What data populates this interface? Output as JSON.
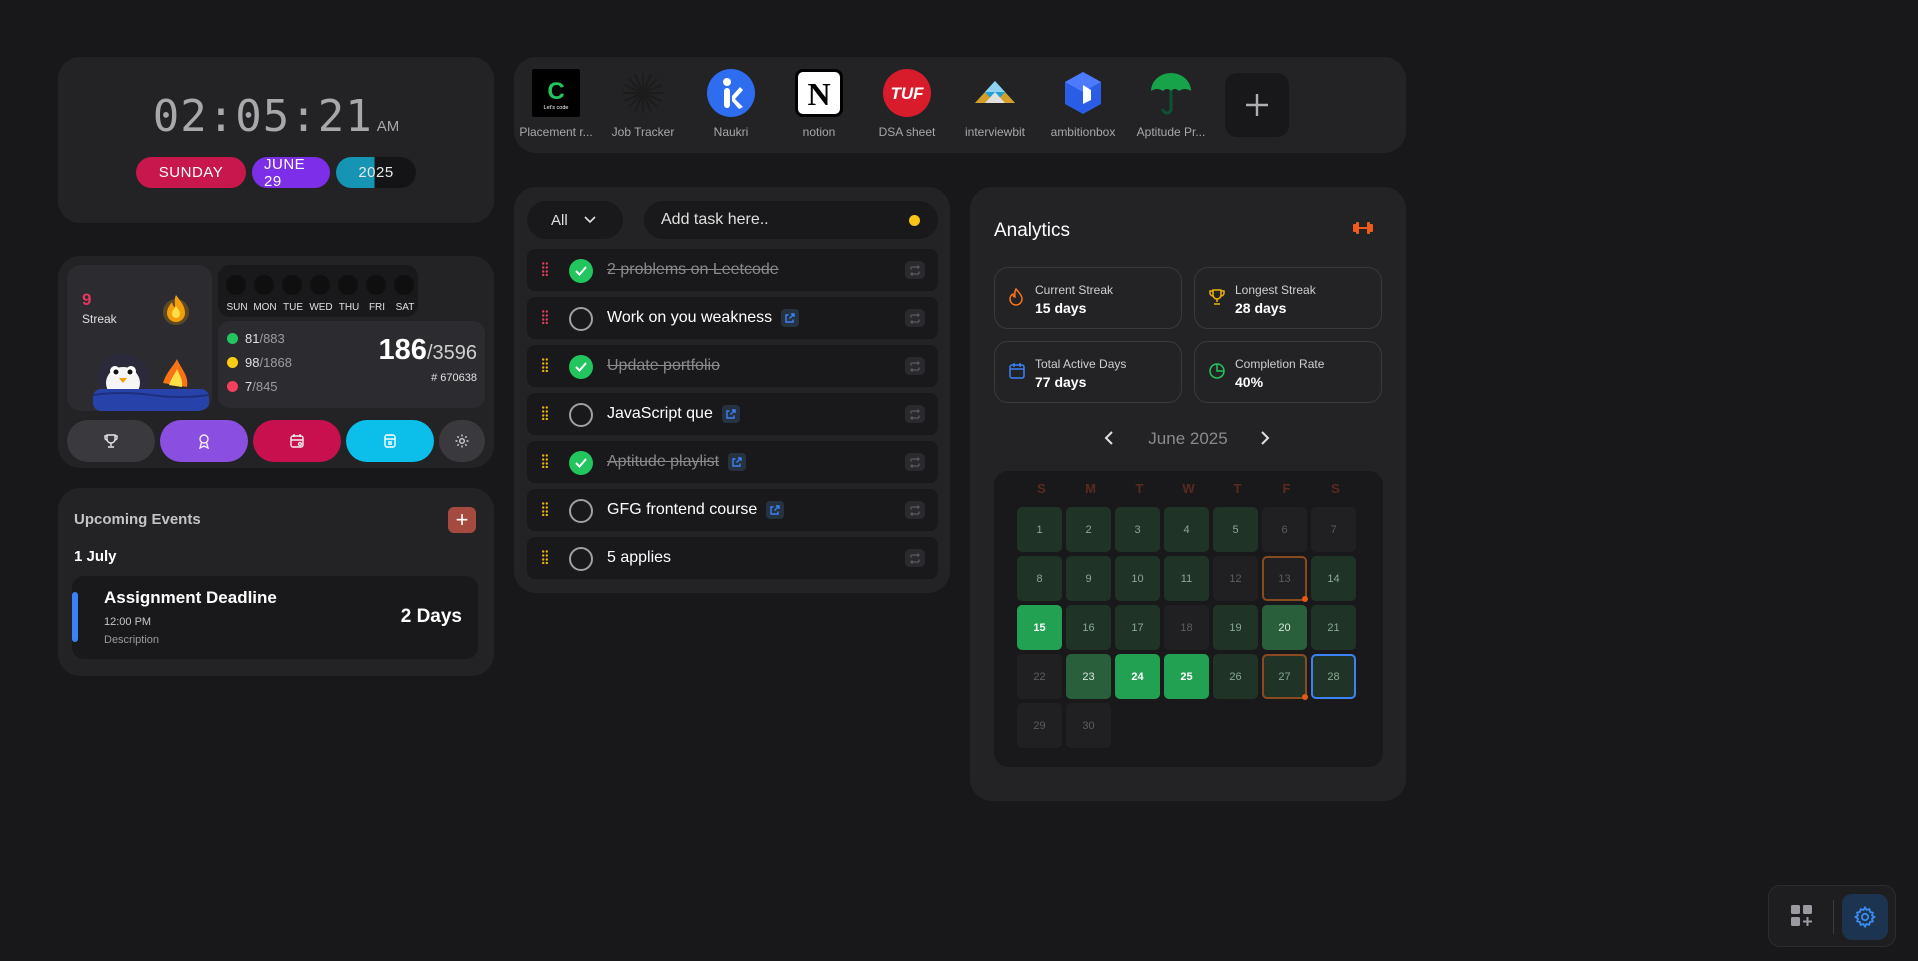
{
  "clock": {
    "time": "02:05:21",
    "ampm": "AM",
    "day": "SUNDAY",
    "date": "JUNE 29",
    "year": "2025"
  },
  "streak": {
    "count": "9",
    "label": "Streak",
    "weekdays": [
      "SUN",
      "MON",
      "TUE",
      "WED",
      "THU",
      "FRI",
      "SAT"
    ],
    "easy": {
      "solved": "81",
      "total": "/883",
      "color": "#22c55e"
    },
    "medium": {
      "solved": "98",
      "total": "/1868",
      "color": "#facc15"
    },
    "hard": {
      "solved": "7",
      "total": "/845",
      "color": "#f43f5e"
    },
    "solved_total": "186",
    "question_total": "/3596",
    "rank": "# 670638",
    "tools": [
      {
        "icon": "trophy-icon",
        "color": "#3a3a3e"
      },
      {
        "icon": "badge-icon",
        "color": "#8a4fe0"
      },
      {
        "icon": "calendar-icon",
        "color": "#c8104e"
      },
      {
        "icon": "notes-icon",
        "color": "#0bbfea"
      },
      {
        "icon": "gear-icon",
        "color": "#3a3a3e"
      }
    ]
  },
  "events": {
    "title": "Upcoming Events",
    "date": "1 July",
    "item": {
      "name": "Assignment Deadline",
      "time": "12:00 PM",
      "description": "Description",
      "remaining": "2 Days"
    }
  },
  "shortcuts": [
    {
      "label": "Placement r...",
      "icon": "placement-logo"
    },
    {
      "label": "Job Tracker",
      "icon": "job-tracker-logo"
    },
    {
      "label": "Naukri",
      "icon": "naukri-logo"
    },
    {
      "label": "notion",
      "icon": "notion-logo"
    },
    {
      "label": "DSA sheet",
      "icon": "tuf-logo"
    },
    {
      "label": "interviewbit",
      "icon": "interviewbit-logo"
    },
    {
      "label": "ambitionbox",
      "icon": "ambitionbox-logo"
    },
    {
      "label": "Aptitude Pr...",
      "icon": "umbrella-logo"
    }
  ],
  "shortcut_logos": {
    "placement": "Let's code",
    "tuf": "TUF",
    "notion": "N"
  },
  "tasks": {
    "filter": "All",
    "input_placeholder": "Add task here..",
    "items": [
      {
        "title": "2 problems on Leetcode",
        "done": true,
        "link": false,
        "grip": "red"
      },
      {
        "title": "Work on you weakness",
        "done": false,
        "link": true,
        "grip": "red"
      },
      {
        "title": "Update portfolio",
        "done": true,
        "link": false,
        "grip": "yellow"
      },
      {
        "title": "JavaScript que",
        "done": false,
        "link": true,
        "grip": "yellow"
      },
      {
        "title": "Aptitude playlist",
        "done": true,
        "link": true,
        "grip": "yellow"
      },
      {
        "title": "GFG frontend course",
        "done": false,
        "link": true,
        "grip": "yellow"
      },
      {
        "title": "5 applies",
        "done": false,
        "link": false,
        "grip": "yellow"
      }
    ]
  },
  "analytics": {
    "title": "Analytics",
    "current_streak": {
      "label": "Current Streak",
      "value": "15 days"
    },
    "longest_streak": {
      "label": "Longest Streak",
      "value": "28 days"
    },
    "total_active": {
      "label": "Total Active Days",
      "value": "77 days"
    },
    "completion": {
      "label": "Completion Rate",
      "value": "40%"
    },
    "month": "June 2025",
    "weekday_heads": [
      "S",
      "M",
      "T",
      "W",
      "T",
      "F",
      "S"
    ],
    "days": [
      {
        "d": "1",
        "lvl": 1
      },
      {
        "d": "2",
        "lvl": 1
      },
      {
        "d": "3",
        "lvl": 1
      },
      {
        "d": "4",
        "lvl": 1
      },
      {
        "d": "5",
        "lvl": 1
      },
      {
        "d": "6",
        "lvl": 0
      },
      {
        "d": "7",
        "lvl": 0
      },
      {
        "d": "8",
        "lvl": 1
      },
      {
        "d": "9",
        "lvl": 1
      },
      {
        "d": "10",
        "lvl": 1
      },
      {
        "d": "11",
        "lvl": 1
      },
      {
        "d": "12",
        "lvl": 0
      },
      {
        "d": "13",
        "lvl": 0,
        "mark": "orange"
      },
      {
        "d": "14",
        "lvl": 1
      },
      {
        "d": "15",
        "lvl": 3
      },
      {
        "d": "16",
        "lvl": 1
      },
      {
        "d": "17",
        "lvl": 1
      },
      {
        "d": "18",
        "lvl": 0
      },
      {
        "d": "19",
        "lvl": 1
      },
      {
        "d": "20",
        "lvl": 2
      },
      {
        "d": "21",
        "lvl": 1
      },
      {
        "d": "22",
        "lvl": 0
      },
      {
        "d": "23",
        "lvl": 2
      },
      {
        "d": "24",
        "lvl": 3
      },
      {
        "d": "25",
        "lvl": 3
      },
      {
        "d": "26",
        "lvl": 1
      },
      {
        "d": "27",
        "lvl": 1,
        "mark": "orange"
      },
      {
        "d": "28",
        "lvl": 1,
        "mark": "blue"
      },
      {
        "d": "29",
        "lvl": 0
      },
      {
        "d": "30",
        "lvl": 0
      }
    ]
  }
}
